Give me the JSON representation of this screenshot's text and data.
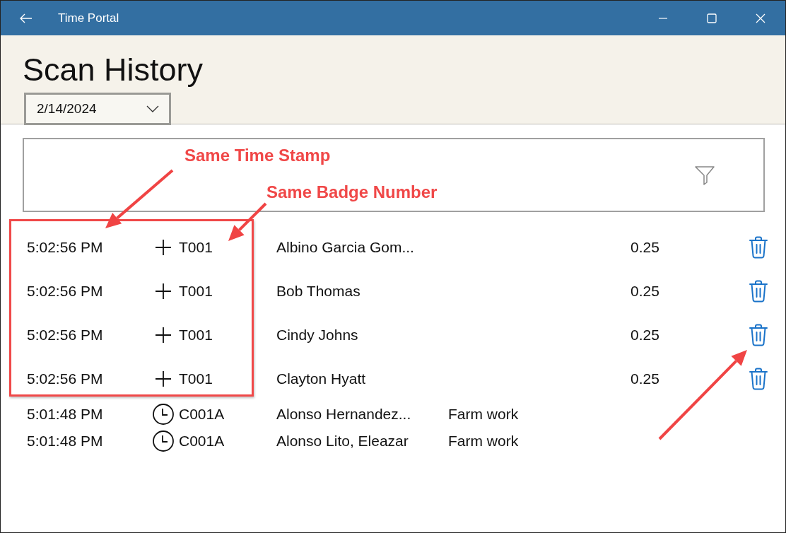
{
  "window": {
    "title": "Time Portal"
  },
  "page": {
    "title": "Scan History"
  },
  "date_picker": {
    "value": "2/14/2024"
  },
  "scans": [
    {
      "time": "5:02:56 PM",
      "kind": "manual",
      "badge": "T001",
      "name": "Albino Garcia Gom...",
      "hours": "0.25",
      "deletable": true
    },
    {
      "time": "5:02:56 PM",
      "kind": "manual",
      "badge": "T001",
      "name": "Bob Thomas",
      "hours": "0.25",
      "deletable": true
    },
    {
      "time": "5:02:56 PM",
      "kind": "manual",
      "badge": "T001",
      "name": "Cindy Johns",
      "hours": "0.25",
      "deletable": true
    },
    {
      "time": "5:02:56 PM",
      "kind": "manual",
      "badge": "T001",
      "name": "Clayton Hyatt",
      "hours": "0.25",
      "deletable": true
    },
    {
      "time": "5:01:48 PM",
      "kind": "clock",
      "badge": "C001A",
      "name": "Alonso Hernandez...",
      "job": "Farm work",
      "deletable": false
    },
    {
      "time": "5:01:48 PM",
      "kind": "clock",
      "badge": "C001A",
      "name": "Alonso Lito, Eleazar",
      "job": "Farm work",
      "deletable": false
    }
  ],
  "annotations": [
    {
      "text": "Same Time Stamp"
    },
    {
      "text": "Same Badge Number"
    }
  ]
}
